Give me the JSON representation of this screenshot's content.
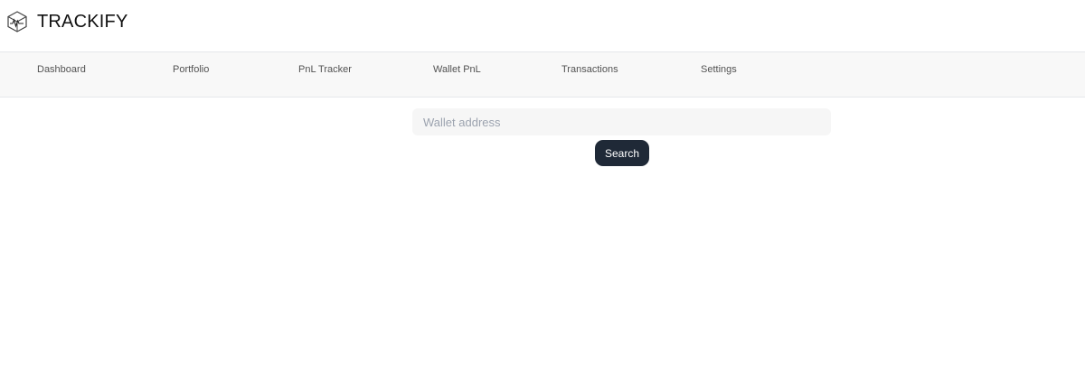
{
  "app": {
    "name": "TRACKIFY",
    "logo_icon": "trackify-logo-icon"
  },
  "nav": {
    "items": [
      {
        "label": "Dashboard"
      },
      {
        "label": "Portfolio"
      },
      {
        "label": "PnL Tracker"
      },
      {
        "label": "Wallet PnL"
      },
      {
        "label": "Transactions"
      },
      {
        "label": "Settings"
      }
    ]
  },
  "search": {
    "placeholder": "Wallet address",
    "value": "",
    "button_label": "Search"
  },
  "colors": {
    "nav_background": "#f8f8f8",
    "button_background": "#1f2937",
    "input_background": "#f6f6f6"
  }
}
